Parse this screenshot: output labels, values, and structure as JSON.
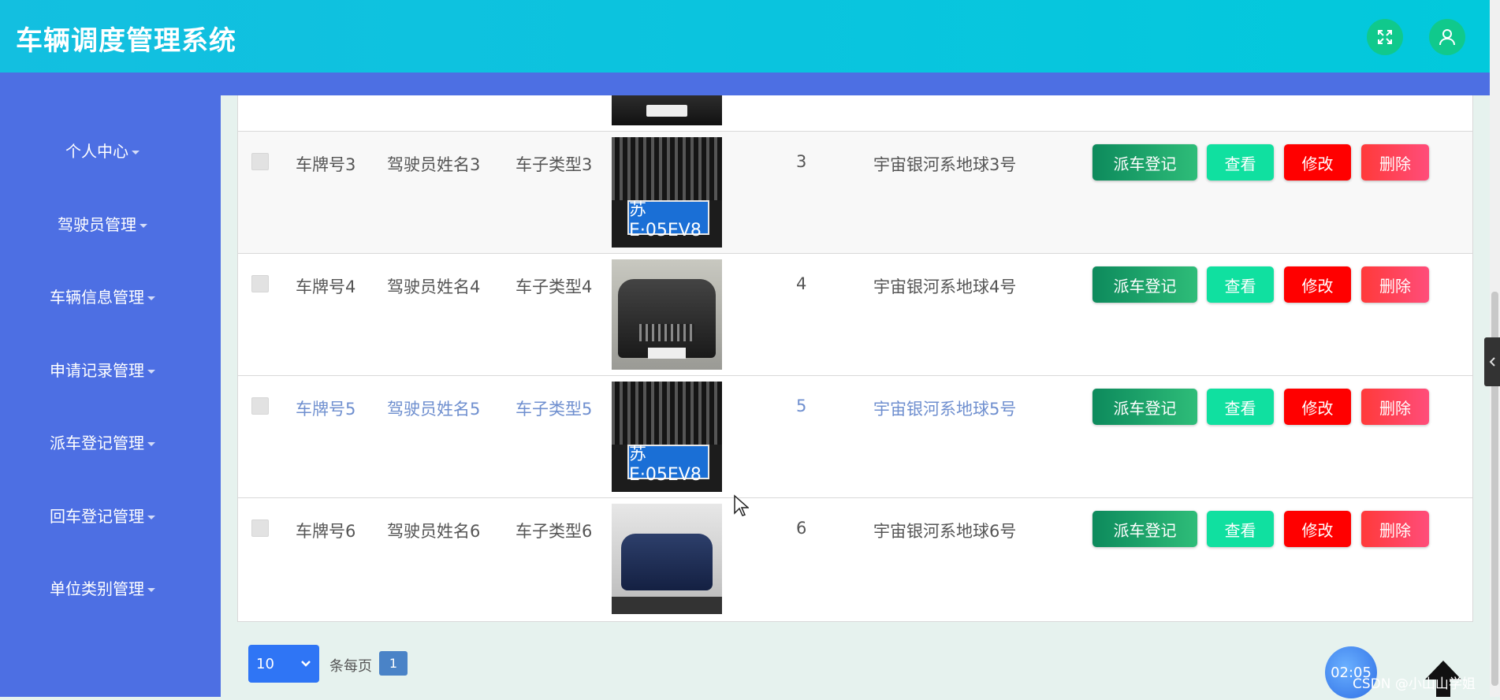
{
  "header": {
    "title": "车辆调度管理系统",
    "fullscreen_icon": "expand-icon",
    "user_icon": "user-icon",
    "accent": "#02c9dc"
  },
  "sidebar": {
    "items": [
      {
        "label": "个人中心"
      },
      {
        "label": "驾驶员管理"
      },
      {
        "label": "车辆信息管理"
      },
      {
        "label": "申请记录管理"
      },
      {
        "label": "派车登记管理"
      },
      {
        "label": "回车登记管理"
      },
      {
        "label": "单位类别管理"
      }
    ],
    "color": "#4d6fe3"
  },
  "table": {
    "rows": [
      {
        "plate": "车牌号3",
        "driver": "驾驶员姓名3",
        "type": "车子类型3",
        "image": "license-plate-photo",
        "num": "3",
        "address": "宇宙银河系地球3号"
      },
      {
        "plate": "车牌号4",
        "driver": "驾驶员姓名4",
        "type": "车子类型4",
        "image": "car-front-photo",
        "num": "4",
        "address": "宇宙银河系地球4号"
      },
      {
        "plate": "车牌号5",
        "driver": "驾驶员姓名5",
        "type": "车子类型5",
        "image": "license-plate-photo",
        "num": "5",
        "address": "宇宙银河系地球5号"
      },
      {
        "plate": "车牌号6",
        "driver": "驾驶员姓名6",
        "type": "车子类型6",
        "image": "blue-car-photo",
        "num": "6",
        "address": "宇宙银河系地球6号"
      }
    ],
    "actions": {
      "dispatch": "派车登记",
      "view": "查看",
      "edit": "修改",
      "delete": "删除"
    }
  },
  "pagination": {
    "page_size": "10",
    "per_page_label": "条每页",
    "current_page": "1"
  },
  "overlay": {
    "timer": "02:05",
    "watermark": "CSDN @小山山学姐"
  }
}
